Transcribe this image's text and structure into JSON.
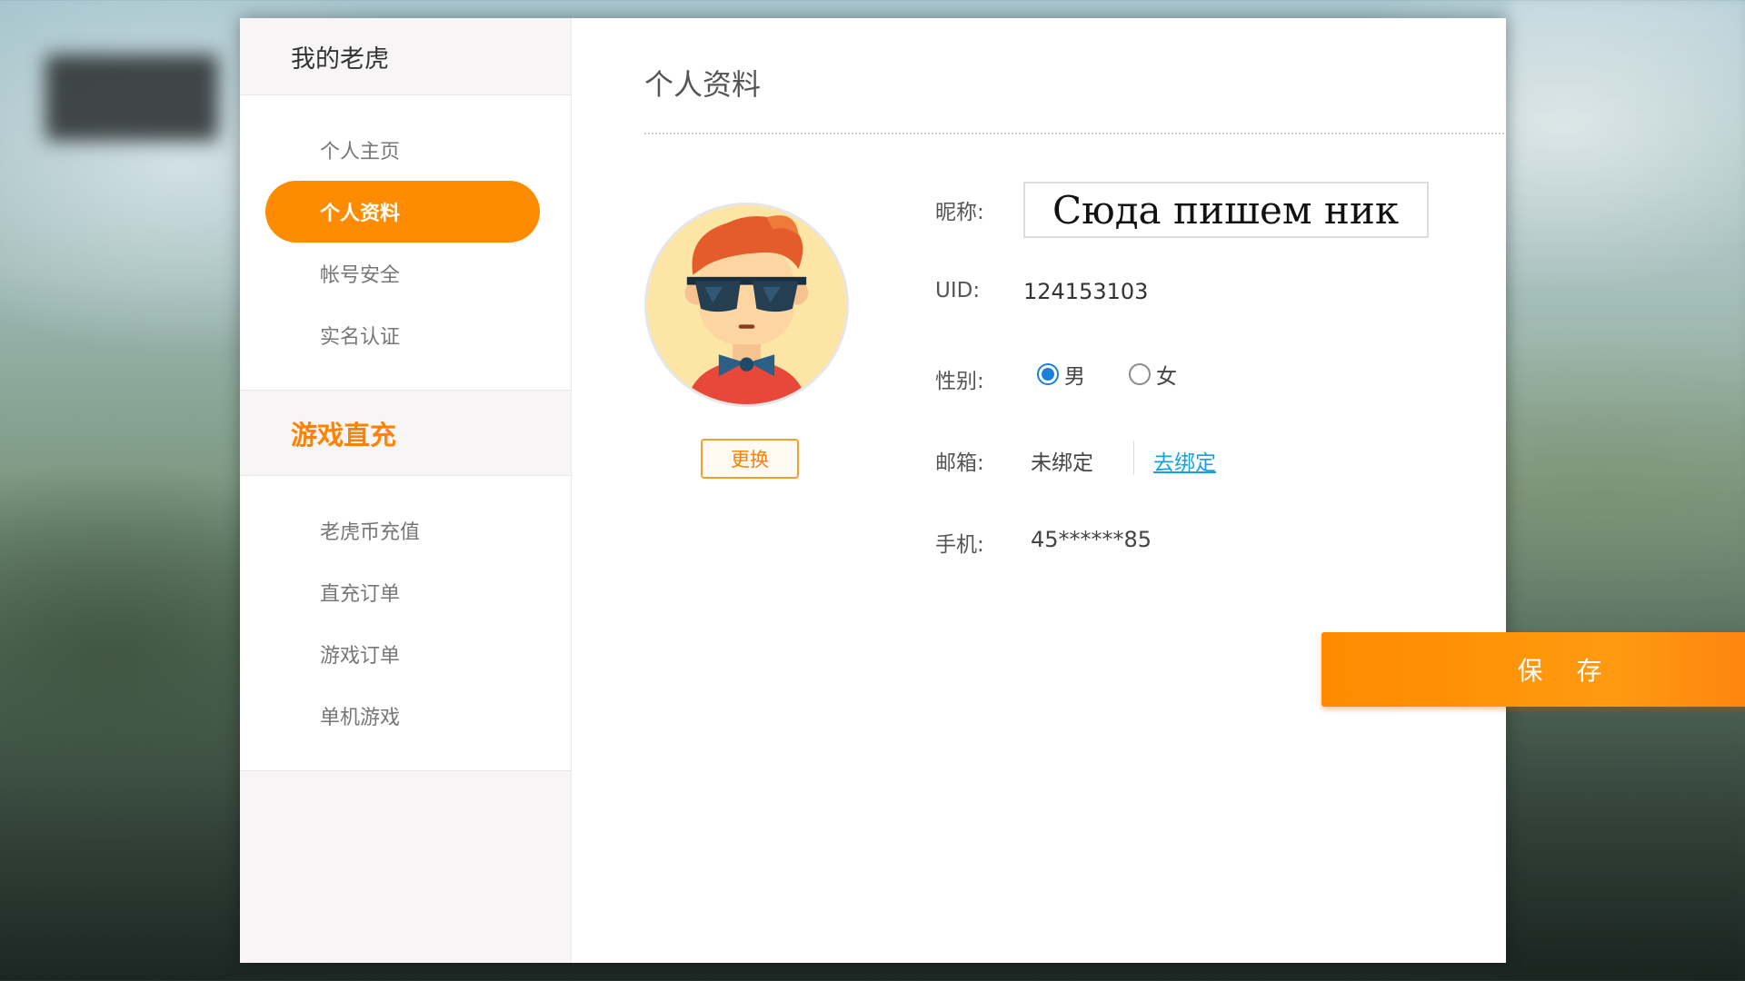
{
  "sidebar": {
    "section1_title": "我的老虎",
    "section1_items": [
      {
        "label": "个人主页"
      },
      {
        "label": "个人资料"
      },
      {
        "label": "帐号安全"
      },
      {
        "label": "实名认证"
      }
    ],
    "section2_title": "游戏直充",
    "section2_items": [
      {
        "label": "老虎币充值"
      },
      {
        "label": "直充订单"
      },
      {
        "label": "游戏订单"
      },
      {
        "label": "单机游戏"
      }
    ]
  },
  "main": {
    "title": "个人资料",
    "avatar_change_label": "更换",
    "nickname_label": "昵称:",
    "nickname_value": "Сюда пишем ник",
    "uid_label": "UID:",
    "uid_value": "124153103",
    "gender_label": "性别:",
    "gender_options": [
      {
        "label": "男",
        "checked": true
      },
      {
        "label": "女",
        "checked": false
      }
    ],
    "email_label": "邮箱:",
    "email_value": "未绑定",
    "email_link": "去绑定",
    "phone_label": "手机:",
    "phone_value": "45******85",
    "save_label": "保 存"
  },
  "colors": {
    "accent": "#ff8c00",
    "link": "#1a9fe0",
    "radio": "#1e7fd8"
  }
}
